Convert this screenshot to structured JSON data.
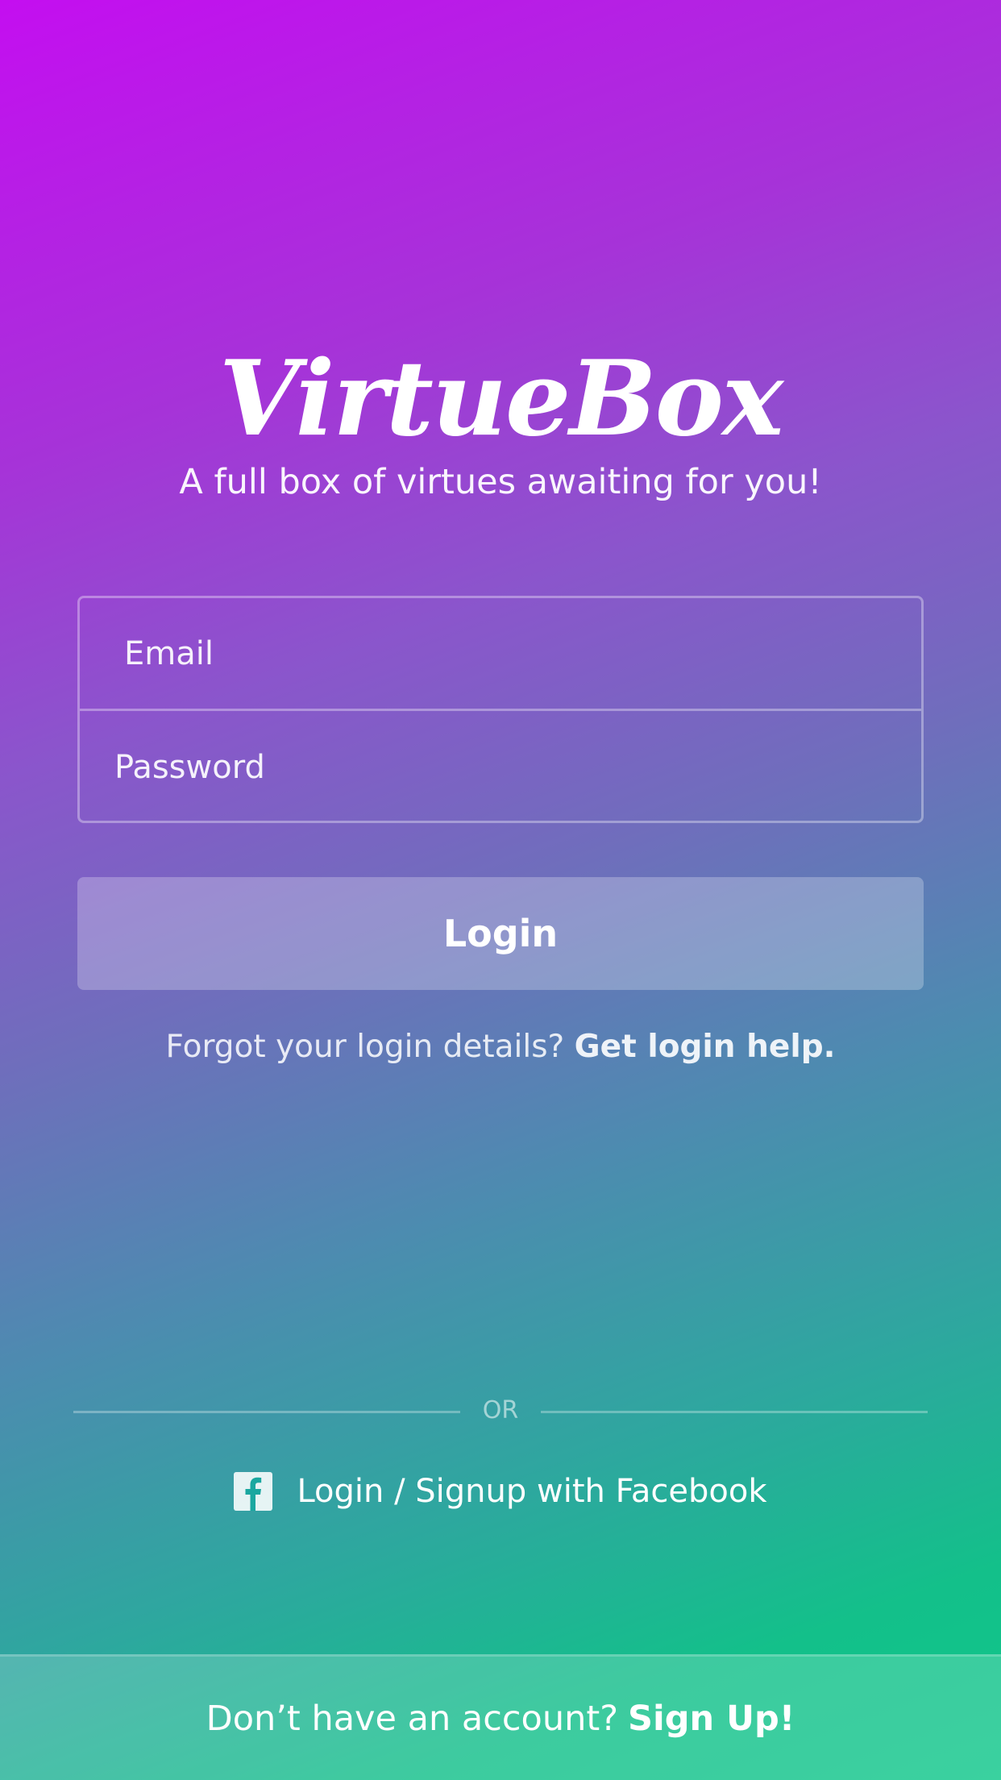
{
  "brand": {
    "logo_text": "VirtueBox",
    "tagline": "A full box of virtues awaiting for you!"
  },
  "form": {
    "email_placeholder": "Email",
    "password_placeholder": "Password",
    "login_label": "Login"
  },
  "help": {
    "prompt": "Forgot your login details?",
    "link": "Get login help."
  },
  "divider": {
    "label": "OR"
  },
  "facebook": {
    "icon": "facebook-icon",
    "label": "Login / Signup with Facebook"
  },
  "footer": {
    "prompt": "Don’t have an account?",
    "link": "Sign Up!"
  },
  "colors": {
    "gradient_top": "#c40ef0",
    "gradient_middle": "#6f6ebc",
    "gradient_bottom": "#0fc78a",
    "facebook_icon_glyph": "#1aa7a0"
  }
}
